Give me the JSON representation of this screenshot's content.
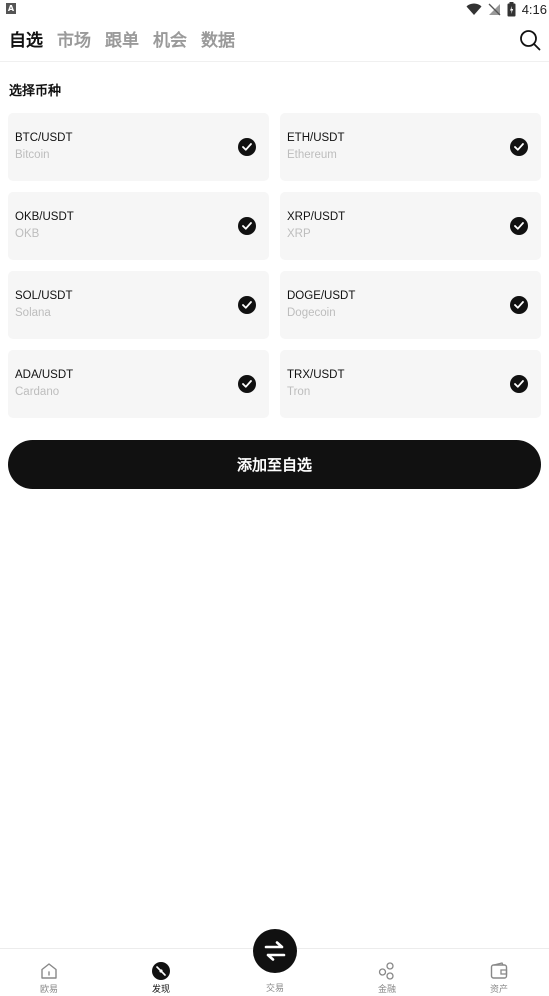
{
  "status_bar": {
    "app_badge": "A",
    "time": "4:16"
  },
  "top_nav": {
    "tabs": [
      {
        "label": "自选",
        "active": true
      },
      {
        "label": "市场",
        "active": false
      },
      {
        "label": "跟单",
        "active": false
      },
      {
        "label": "机会",
        "active": false
      },
      {
        "label": "数据",
        "active": false
      }
    ],
    "search_icon": "search-icon"
  },
  "section": {
    "title": "选择币种"
  },
  "pairs": [
    {
      "pair": "BTC/USDT",
      "name": "Bitcoin",
      "checked": true
    },
    {
      "pair": "ETH/USDT",
      "name": "Ethereum",
      "checked": true
    },
    {
      "pair": "OKB/USDT",
      "name": "OKB",
      "checked": true
    },
    {
      "pair": "XRP/USDT",
      "name": "XRP",
      "checked": true
    },
    {
      "pair": "SOL/USDT",
      "name": "Solana",
      "checked": true
    },
    {
      "pair": "DOGE/USDT",
      "name": "Dogecoin",
      "checked": true
    },
    {
      "pair": "ADA/USDT",
      "name": "Cardano",
      "checked": true
    },
    {
      "pair": "TRX/USDT",
      "name": "Tron",
      "checked": true
    }
  ],
  "add_button": {
    "label": "添加至自选"
  },
  "bottom_nav": {
    "items": [
      {
        "label": "欧易",
        "icon": "home-icon",
        "active": false
      },
      {
        "label": "发现",
        "icon": "discover-icon",
        "active": true
      },
      {
        "label": "交易",
        "icon": "swap-icon",
        "active": false
      },
      {
        "label": "金融",
        "icon": "finance-icon",
        "active": false
      },
      {
        "label": "资产",
        "icon": "wallet-icon",
        "active": false
      }
    ]
  },
  "colors": {
    "primary": "#111111",
    "card_bg": "#f6f6f6",
    "inactive_tab": "#9a9a9a",
    "muted_text": "#bdbdbd"
  }
}
